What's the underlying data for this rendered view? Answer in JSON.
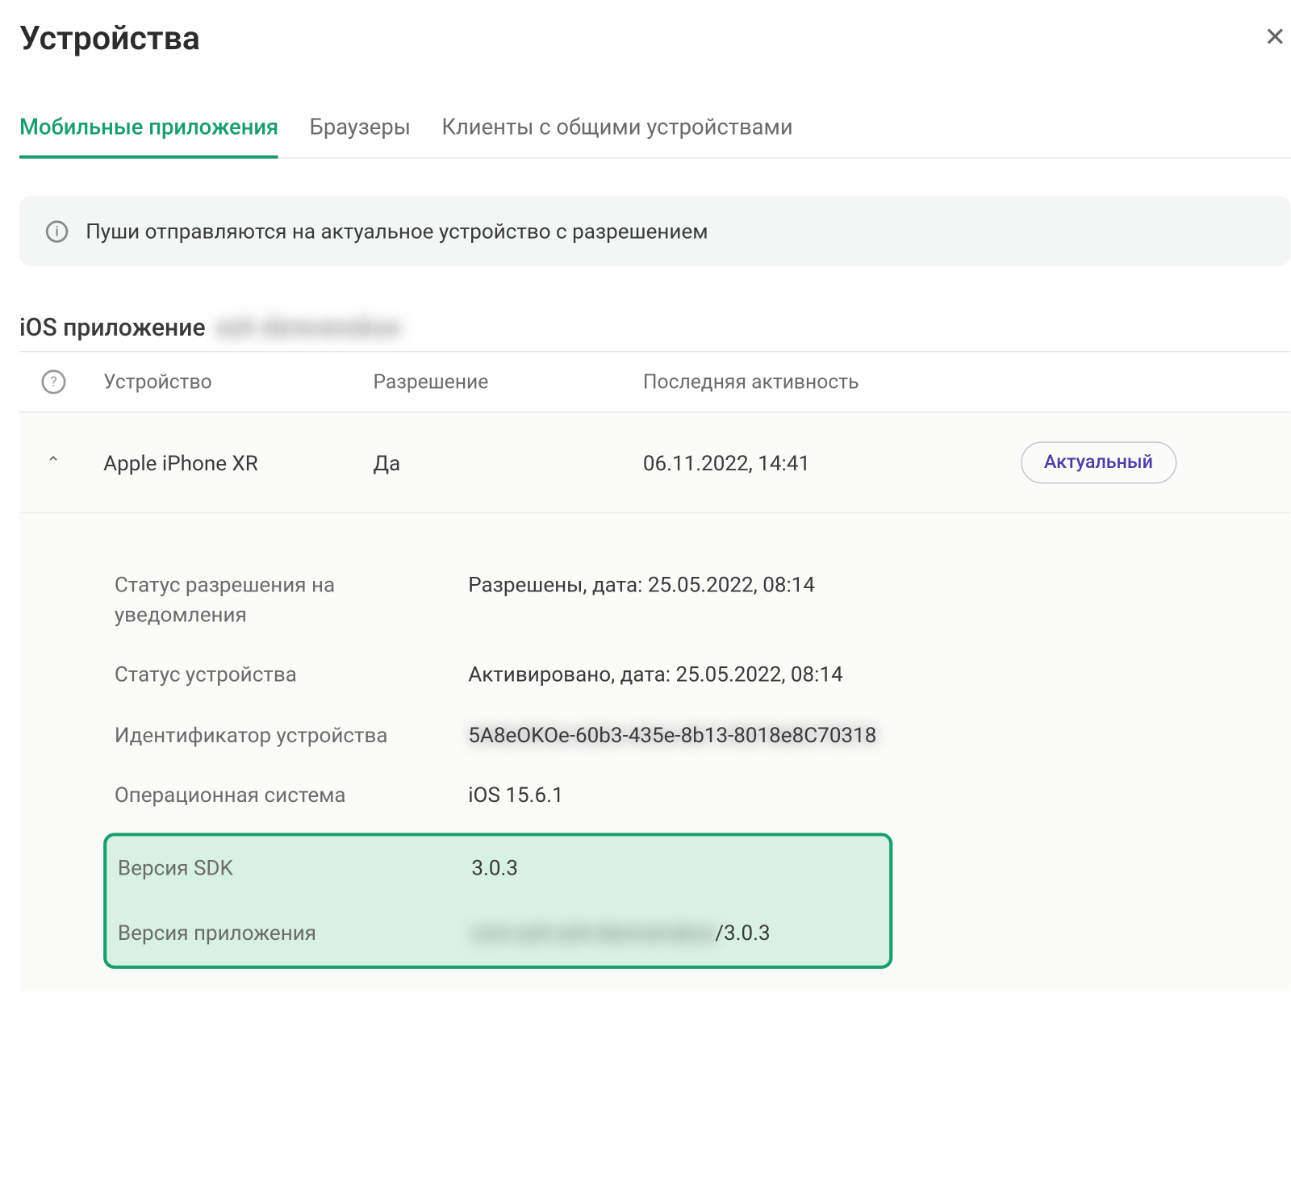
{
  "header": {
    "title": "Устройства"
  },
  "tabs": {
    "mobile": "Мобильные приложения",
    "browsers": "Браузеры",
    "shared": "Клиенты с общими устройствами"
  },
  "banner": {
    "text": "Пуши отправляются на актуальное устройство с разрешением"
  },
  "section": {
    "title": "iOS приложение",
    "app_name_blurred": "esh derevenskoe"
  },
  "table": {
    "headers": {
      "device": "Устройство",
      "permission": "Разрешение",
      "last_activity": "Последняя активность"
    },
    "row": {
      "device": "Apple iPhone XR",
      "permission": "Да",
      "last_activity": "06.11.2022, 14:41",
      "badge": "Актуальный"
    }
  },
  "details": {
    "notification_status": {
      "label": "Статус разрешения на уведомления",
      "value": "Разрешены, дата: 25.05.2022, 08:14"
    },
    "device_status": {
      "label": "Статус устройства",
      "value": "Активировано, дата: 25.05.2022, 08:14"
    },
    "device_id": {
      "label": "Идентификатор устройства",
      "value_blurred": "5A8eOKOe-60b3-435e-8b13-8018e8C70318"
    },
    "os": {
      "label": "Операционная система",
      "value": "iOS 15.6.1"
    },
    "sdk_version": {
      "label": "Версия SDK",
      "value": "3.0.3"
    },
    "app_version": {
      "label": "Версия приложения",
      "value_blurred": "com.esh.esh-derevenskoe",
      "value_suffix": "/3.0.3"
    }
  }
}
